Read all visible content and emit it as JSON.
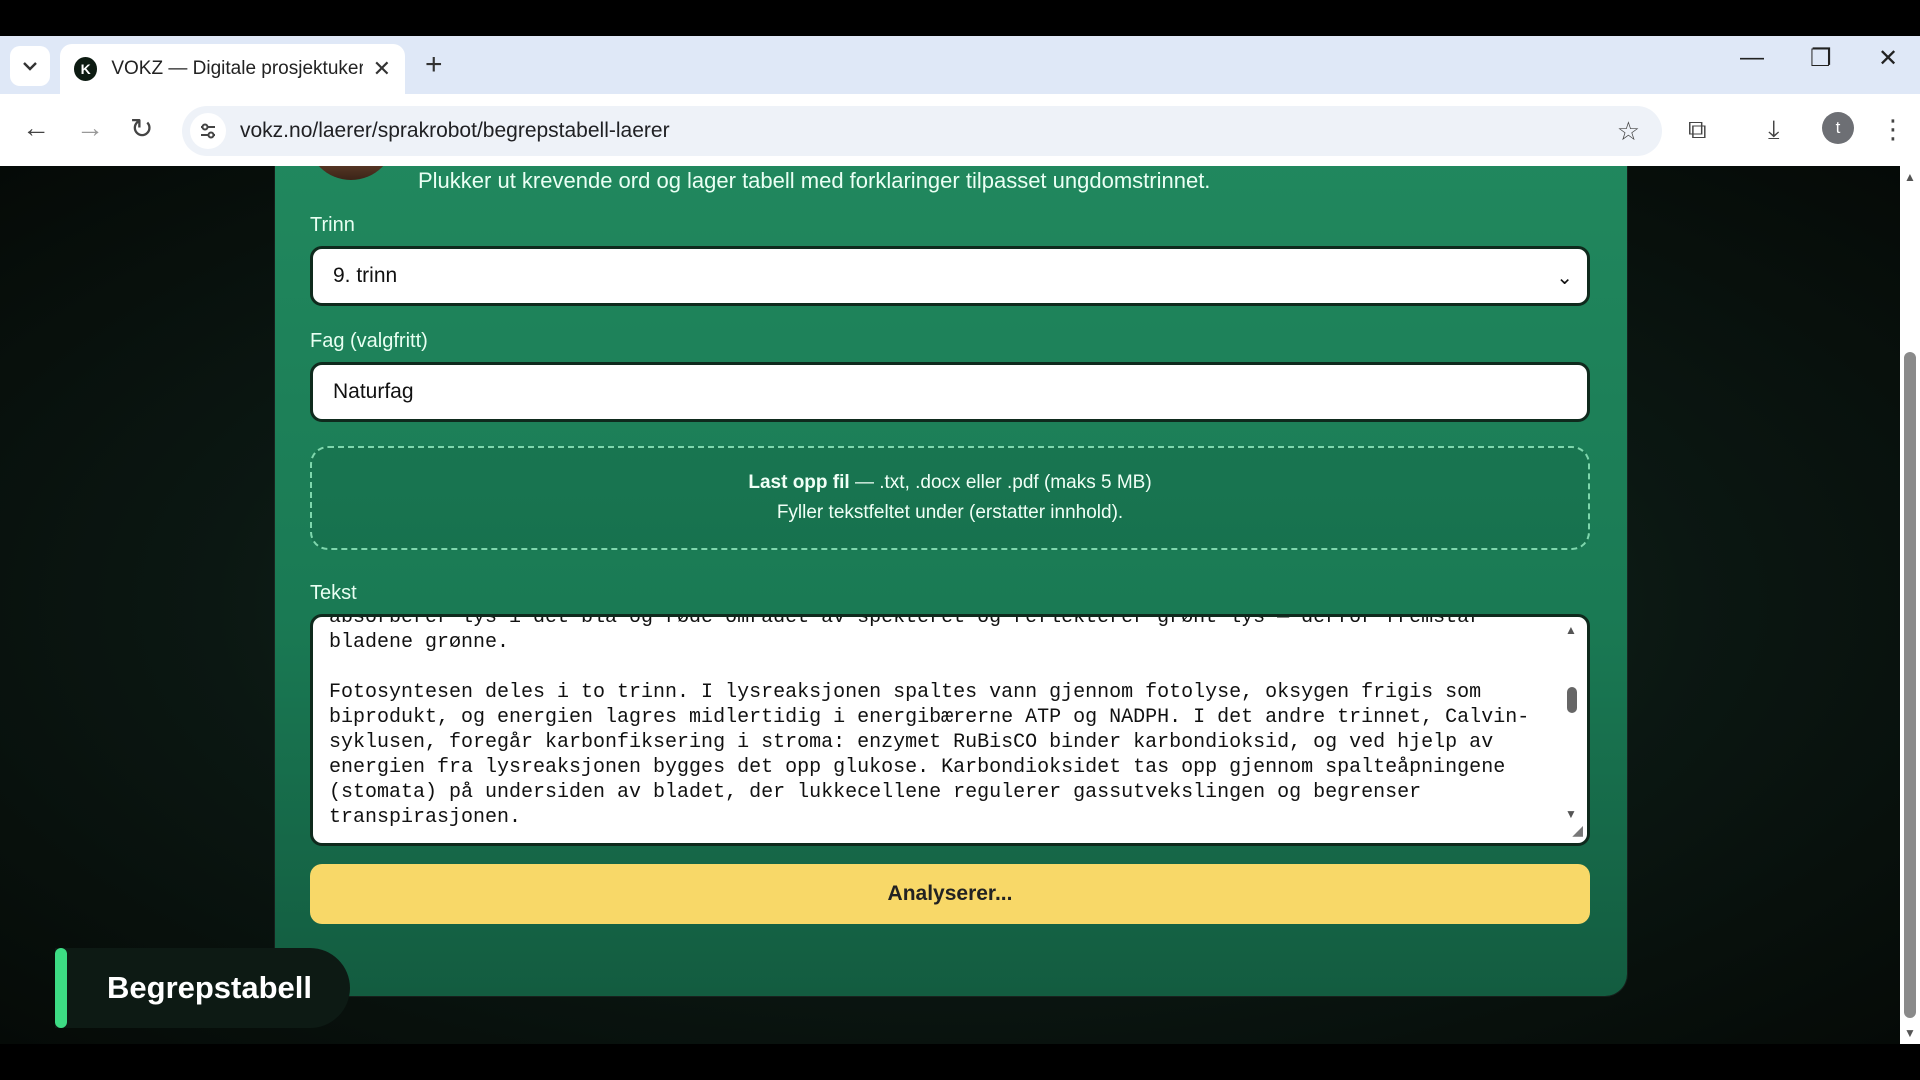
{
  "browser": {
    "tab_title": "VOKZ — Digitale prosjektuker og",
    "favicon_letter": "K",
    "url": "vokz.no/laerer/sprakrobot/begrepstabell-laerer",
    "profile_letter": "t"
  },
  "page": {
    "description": "Plukker ut krevende ord og lager tabell med forklaringer tilpasset ungdomstrinnet.",
    "trinn_label": "Trinn",
    "trinn_value": "9. trinn",
    "fag_label": "Fag (valgfritt)",
    "fag_value": "Naturfag",
    "upload_title": "Last opp fil",
    "upload_formats": " — .txt, .docx eller .pdf (maks 5 MB)",
    "upload_sub": "Fyller tekstfeltet under (erstatter innhold).",
    "tekst_label": "Tekst",
    "submit_label": "Analyserer...",
    "badge_label": "Begrepstabell"
  },
  "textarea_lines": {
    "l1": "absorberer lys i det blå og røde området av spekteret og reflekterer grønt lys — derfor fremstår",
    "l2": "bladene grønne.",
    "l3": "",
    "l4": "Fotosyntesen deles i to trinn. I lysreaksjonen spaltes vann gjennom fotolyse, oksygen frigis som",
    "l5": "biprodukt, og energien lagres midlertidig i energibærerne ATP og NADPH. I det andre trinnet, Calvin-",
    "l6": "syklusen, foregår karbonfiksering i stroma: enzymet RuBisCO binder karbondioksid, og ved hjelp av",
    "l7": "energien fra lysreaksjonen bygges det opp glukose. Karbondioksidet tas opp gjennom spalteåpningene",
    "l8": "(stomata) på undersiden av bladet, der lukkecellene regulerer gassutvekslingen og begrenser",
    "l9": "transpirasjonen."
  },
  "icons": {
    "tab_search": "chevron-down-icon",
    "close": "close-icon",
    "new_tab": "plus-icon",
    "back": "back-arrow-icon",
    "forward": "forward-arrow-icon",
    "reload": "reload-icon",
    "site_controls": "tune-icon",
    "bookmark": "star-icon",
    "extensions": "puzzle-icon",
    "downloads": "download-icon",
    "menu": "kebab-menu-icon"
  },
  "colors": {
    "card_green": "#21885e",
    "submit_yellow": "#f8d868",
    "badge_accent": "#3ddc84"
  }
}
